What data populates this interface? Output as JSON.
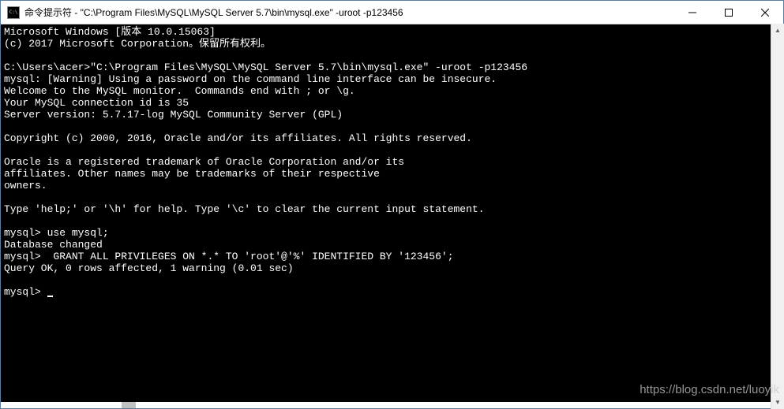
{
  "window": {
    "title": "命令提示符 - \"C:\\Program Files\\MySQL\\MySQL Server 5.7\\bin\\mysql.exe\"  -uroot -p123456"
  },
  "terminal": {
    "lines": [
      "Microsoft Windows [版本 10.0.15063]",
      "(c) 2017 Microsoft Corporation。保留所有权利。",
      "",
      "C:\\Users\\acer>\"C:\\Program Files\\MySQL\\MySQL Server 5.7\\bin\\mysql.exe\" -uroot -p123456",
      "mysql: [Warning] Using a password on the command line interface can be insecure.",
      "Welcome to the MySQL monitor.  Commands end with ; or \\g.",
      "Your MySQL connection id is 35",
      "Server version: 5.7.17-log MySQL Community Server (GPL)",
      "",
      "Copyright (c) 2000, 2016, Oracle and/or its affiliates. All rights reserved.",
      "",
      "Oracle is a registered trademark of Oracle Corporation and/or its",
      "affiliates. Other names may be trademarks of their respective",
      "owners.",
      "",
      "Type 'help;' or '\\h' for help. Type '\\c' to clear the current input statement.",
      "",
      "mysql> use mysql;",
      "Database changed",
      "mysql>  GRANT ALL PRIVILEGES ON *.* TO 'root'@'%' IDENTIFIED BY '123456';",
      "Query OK, 0 rows affected, 1 warning (0.01 sec)",
      "",
      "mysql> "
    ]
  },
  "watermark": "https://blog.csdn.net/luoyik"
}
